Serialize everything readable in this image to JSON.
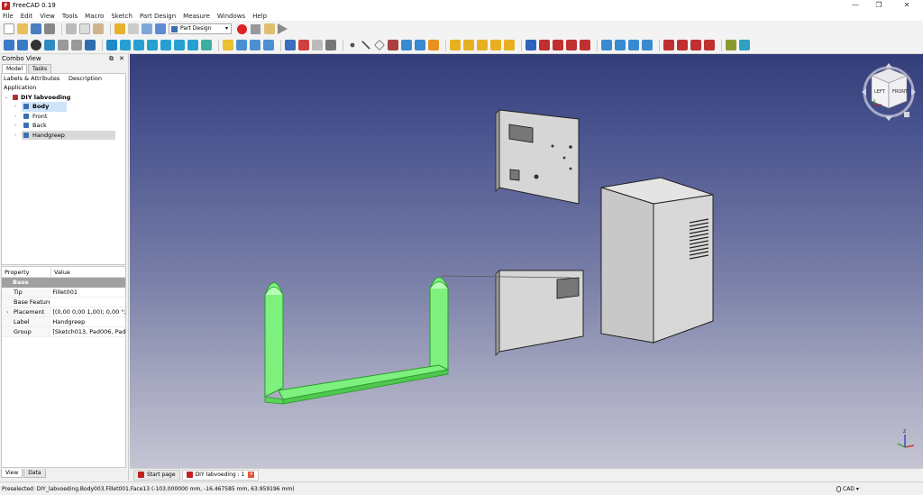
{
  "window": {
    "title": "FreeCAD 0.19",
    "app_icon": "freecad-icon",
    "controls": [
      "—",
      "❐",
      "✕"
    ]
  },
  "menu": [
    "File",
    "Edit",
    "View",
    "Tools",
    "Macro",
    "Sketch",
    "Part Design",
    "Measure",
    "Windows",
    "Help"
  ],
  "toolbar": {
    "workbench": "Part Design",
    "workbench_icon": "part-design-icon"
  },
  "combo": {
    "title": "Combo View",
    "tabs": [
      "Model",
      "Tasks"
    ],
    "tree": {
      "columns": [
        "Labels & Attributes",
        "Description"
      ],
      "root_label": "Application",
      "document": "DIY labvoeding",
      "items": [
        {
          "label": "Body",
          "icon": "body-icon"
        },
        {
          "label": "Front",
          "icon": "body-icon"
        },
        {
          "label": "Back",
          "icon": "body-icon"
        },
        {
          "label": "Handgreep",
          "icon": "body-icon"
        }
      ]
    },
    "properties": {
      "headers": [
        "Property",
        "Value"
      ],
      "group": "Base",
      "rows": [
        {
          "name": "Tip",
          "value": "Fillet001"
        },
        {
          "name": "Base Feature",
          "value": ""
        },
        {
          "name": "Placement",
          "value": "[(0,00 0,00 1,00); 0,00 °; (-..."
        },
        {
          "name": "Label",
          "value": "Handgreep"
        },
        {
          "name": "Group",
          "value": "[Sketch013, Pad006, Pad0..."
        }
      ]
    },
    "bottom_tabs": [
      "View",
      "Data"
    ]
  },
  "navcube": {
    "faces": [
      "LEFT",
      "FRONT"
    ]
  },
  "doc_tabs": [
    {
      "label": "Start page",
      "active": false
    },
    {
      "label": "DIY labvoeding : 1",
      "active": true
    }
  ],
  "status": {
    "text": "Preselected: DIY_labvoeding.Body003.Fillet001.Face13 (-103.000000 mm, -16.467585 mm, 63.959196 mm)",
    "nav_style": "CAD"
  },
  "colors": {
    "selection": "#7ef07e",
    "view_top": "#333d78",
    "view_bottom": "#c4c4d2"
  }
}
